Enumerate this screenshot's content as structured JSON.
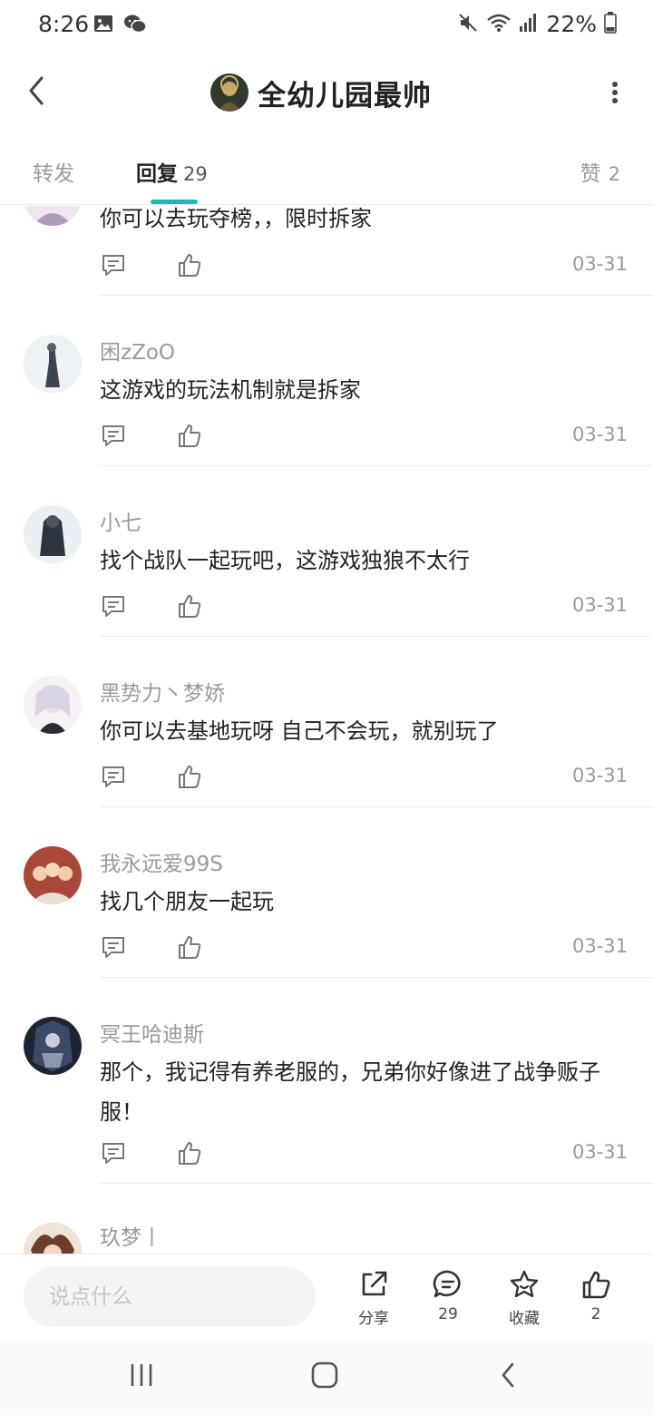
{
  "status_bar": {
    "time": "8:26",
    "battery_percent": "22%",
    "left_icons": [
      "gallery-icon",
      "wechat-icon"
    ],
    "right_icons": [
      "mute-icon",
      "wifi-icon",
      "signal-icon",
      "battery-icon"
    ]
  },
  "header": {
    "title": "全幼儿园最帅",
    "back_icon": "chevron-left-icon",
    "more_icon": "more-vertical-icon"
  },
  "tabs": {
    "forward": {
      "label": "转发"
    },
    "reply": {
      "label": "回复",
      "count": "29",
      "active": true
    },
    "like": {
      "label": "赞",
      "count": "2"
    },
    "accent_color": "#25b3b3"
  },
  "comments": [
    {
      "username": "",
      "content": "你可以去玩夺榜，，限时拆家",
      "date": "03-31"
    },
    {
      "username": "困zZoO",
      "content": "这游戏的玩法机制就是拆家",
      "date": "03-31"
    },
    {
      "username": "小七",
      "content": "找个战队一起玩吧，这游戏独狼不太行",
      "date": "03-31"
    },
    {
      "username": "黑势力丶梦娇",
      "content": "你可以去基地玩呀 自己不会玩，就别玩了",
      "date": "03-31"
    },
    {
      "username": "我永远爱99S",
      "content": "找几个朋友一起玩",
      "date": "03-31"
    },
    {
      "username": "冥王哈迪斯",
      "content": "那个，我记得有养老服的，兄弟你好像进了战争贩子服！",
      "date": "03-31"
    },
    {
      "username": "玖梦丨",
      "content": "",
      "date": ""
    }
  ],
  "bottom_bar": {
    "input_placeholder": "说点什么",
    "share_label": "分享",
    "comment_count": "29",
    "favorite_label": "收藏",
    "like_count": "2"
  }
}
